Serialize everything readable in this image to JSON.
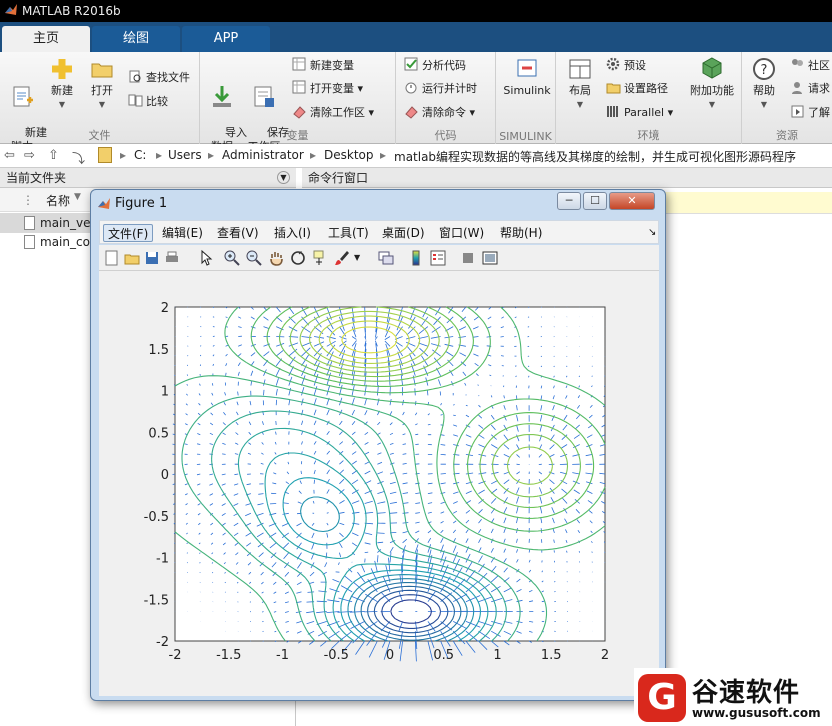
{
  "window": {
    "title": "MATLAB R2016b"
  },
  "tabs": [
    {
      "label": "主页"
    },
    {
      "label": "绘图"
    },
    {
      "label": "APP"
    }
  ],
  "ribbon": {
    "file": {
      "label": "文件",
      "new_script": "新建\n脚本",
      "new": "新建",
      "open": "打开",
      "find_files": "查找文件",
      "compare": "比较"
    },
    "variable": {
      "label": "变量",
      "import": "导入\n数据",
      "save_ws": "保存\n工作区",
      "new_var": "新建变量",
      "open_var": "打开变量",
      "clear_ws": "清除工作区"
    },
    "code": {
      "label": "代码",
      "analyze": "分析代码",
      "run_time": "运行并计时",
      "clear_cmd": "清除命令"
    },
    "simulink": {
      "label": "SIMULINK",
      "simulink": "Simulink"
    },
    "env": {
      "label": "环境",
      "layout": "布局",
      "prefs": "预设",
      "set_path": "设置路径",
      "parallel": "Parallel",
      "addons": "附加功能"
    },
    "res": {
      "label": "资源",
      "help": "帮助",
      "community": "社区",
      "request": "请求",
      "learn": "了解"
    }
  },
  "address": {
    "path": [
      "C:",
      "Users",
      "Administrator",
      "Desktop",
      "matlab编程实现数据的等高线及其梯度的绘制，并生成可视化图形源码程序"
    ]
  },
  "left_pane": {
    "title": "当前文件夹",
    "col_name": "名称",
    "files": [
      {
        "name": "main_vec"
      },
      {
        "name": "main_co"
      }
    ]
  },
  "right_pane": {
    "title": "命令行窗口"
  },
  "figure": {
    "title": "Figure 1",
    "menus": [
      "文件(F)",
      "编辑(E)",
      "查看(V)",
      "插入(I)",
      "工具(T)",
      "桌面(D)",
      "窗口(W)",
      "帮助(H)"
    ]
  },
  "chart_data": {
    "type": "contour",
    "title": "",
    "xlabel": "",
    "ylabel": "",
    "xlim": [
      -2,
      2
    ],
    "ylim": [
      -2,
      2
    ],
    "xticks": [
      "-2",
      "-1.5",
      "-1",
      "-0.5",
      "0",
      "0.5",
      "1",
      "1.5",
      "2"
    ],
    "yticks": [
      "2",
      "1.5",
      "1",
      "0.5",
      "0",
      "-0.5",
      "-1",
      "-1.5",
      "-2"
    ],
    "overlay": "quiver",
    "colors": {
      "low": "#2a2f8e",
      "mid": "#1fa0b0",
      "high": "#e8e23a",
      "arrows": "#2a6fd6"
    }
  },
  "watermark": {
    "brand": "谷速软件",
    "url": "www.gususoft.com",
    "logo_letter": "G"
  }
}
